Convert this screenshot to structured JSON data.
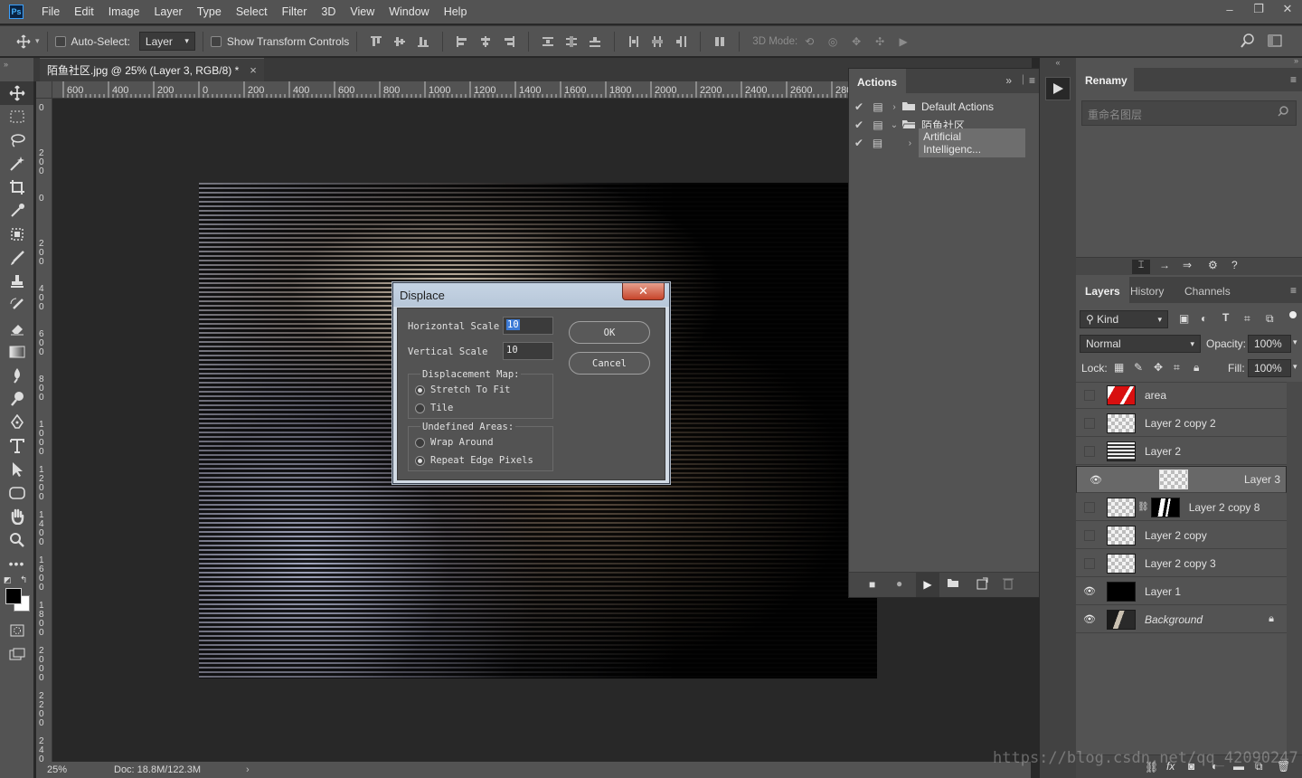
{
  "app": {
    "logo": "Ps",
    "menus": [
      "File",
      "Edit",
      "Image",
      "Layer",
      "Type",
      "Select",
      "Filter",
      "3D",
      "View",
      "Window",
      "Help"
    ],
    "window_controls": [
      "–",
      "❐",
      "✕"
    ]
  },
  "options_bar": {
    "auto_select_label": "Auto-Select:",
    "auto_select_target": "Layer",
    "show_transform_label": "Show Transform Controls",
    "mode_3d_label": "3D Mode:"
  },
  "document": {
    "tab_title": "陌鱼社区.jpg @ 25% (Layer 3, RGB/8) *",
    "tab_close": "×",
    "ruler_top": [
      "600",
      "400",
      "200",
      "0",
      "200",
      "400",
      "600",
      "800",
      "1000",
      "1200",
      "1400",
      "1600",
      "1800",
      "2000",
      "2200",
      "2400",
      "2600",
      "280"
    ],
    "ruler_left": [
      "0",
      "2 0 0",
      "0",
      "2 0 0",
      "4 0 0",
      "6 0 0",
      "8 0 0",
      "1 0 0 0",
      "1 2 0 0",
      "1 4 0 0",
      "1 6 0 0",
      "1 8 0 0",
      "2 0 0 0",
      "2 2 0 0",
      "2 4 0 0"
    ],
    "zoom": "25%",
    "doc_info": "Doc: 18.8M/122.3M",
    "watermark": "https://blog.csdn.net/qq_42090247"
  },
  "displace_dialog": {
    "title": "Displace",
    "close": "✕",
    "horizontal_scale_label": "Horizontal Scale",
    "horizontal_scale_value": "10",
    "vertical_scale_label": "Vertical Scale",
    "vertical_scale_value": "10",
    "map_group_label": "Displacement Map:",
    "map_options": [
      "Stretch To Fit",
      "Tile"
    ],
    "map_selected": "Stretch To Fit",
    "undefined_group_label": "Undefined Areas:",
    "undefined_options": [
      "Wrap Around",
      "Repeat Edge Pixels"
    ],
    "undefined_selected": "Repeat Edge Pixels",
    "ok_label": "OK",
    "cancel_label": "Cancel"
  },
  "actions_panel": {
    "tab": "Actions",
    "items": [
      {
        "label": "Default Actions",
        "kind": "set",
        "expanded": false
      },
      {
        "label": "陌鱼社区",
        "kind": "set",
        "expanded": true
      },
      {
        "label": "Artificial Intelligenc...",
        "kind": "action",
        "expanded": false
      }
    ]
  },
  "renamy_panel": {
    "tab": "Renamy",
    "search_placeholder": "重命名图层"
  },
  "layers_panel": {
    "tabs": [
      "Layers",
      "History",
      "Channels"
    ],
    "filter_kind": "Kind",
    "blend_mode": "Normal",
    "opacity_label": "Opacity:",
    "opacity_value": "100%",
    "lock_label": "Lock:",
    "fill_label": "Fill:",
    "fill_value": "100%",
    "layers": [
      {
        "name": "area",
        "visible": false,
        "thumb": "red"
      },
      {
        "name": "Layer 2 copy 2",
        "visible": false,
        "thumb": "checker"
      },
      {
        "name": "Layer 2",
        "visible": false,
        "thumb": "stripes"
      },
      {
        "name": "Layer 3",
        "visible": true,
        "thumb": "checker",
        "selected": true
      },
      {
        "name": "Layer 2 copy 8",
        "visible": false,
        "thumb": "checker",
        "mask": true
      },
      {
        "name": "Layer 2 copy",
        "visible": false,
        "thumb": "checker"
      },
      {
        "name": "Layer 2 copy 3",
        "visible": false,
        "thumb": "checker"
      },
      {
        "name": "Layer 1",
        "visible": true,
        "thumb": "black"
      },
      {
        "name": "Background",
        "visible": true,
        "thumb": "photo",
        "locked": true
      }
    ]
  },
  "colors": {
    "ui_panel": "#535353",
    "ui_dark": "#424242",
    "canvas": "#282828",
    "dialog_frame": "#d2dbe5",
    "close_button": "#c7452b",
    "selection_highlight": "#3d7bd6"
  }
}
